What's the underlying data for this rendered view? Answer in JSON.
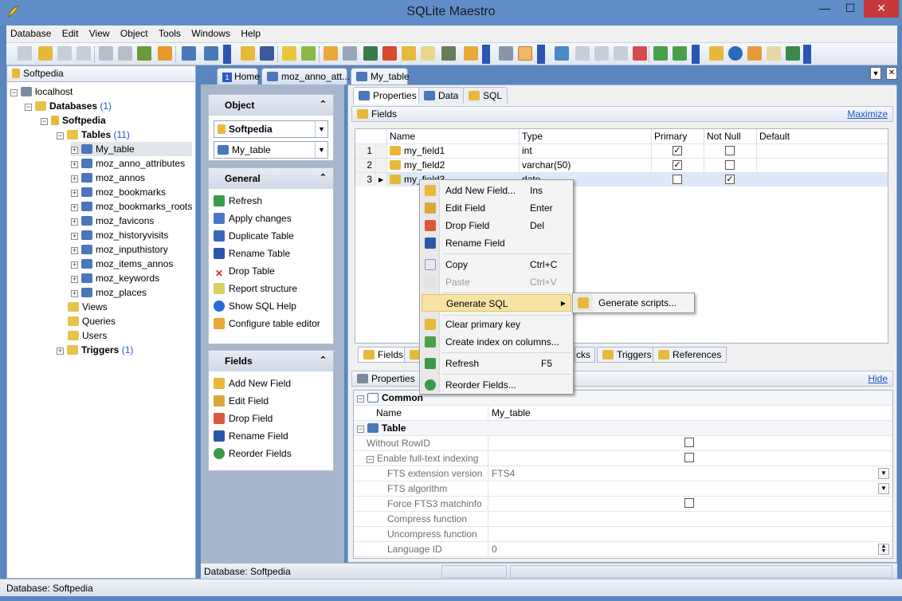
{
  "window": {
    "title": "SQLite Maestro",
    "minimize": "—",
    "maximize": "☐",
    "close": "✕"
  },
  "menu": [
    "Database",
    "Edit",
    "View",
    "Object",
    "Tools",
    "Windows",
    "Help"
  ],
  "left_panel": {
    "title": "Softpedia",
    "tree": {
      "host": "localhost",
      "databases": {
        "label": "Databases",
        "count": "(1)"
      },
      "db": "Softpedia",
      "tables": {
        "label": "Tables",
        "count": "(11)"
      },
      "table_items": [
        "My_table",
        "moz_anno_attributes",
        "moz_annos",
        "moz_bookmarks",
        "moz_bookmarks_roots",
        "moz_favicons",
        "moz_historyvisits",
        "moz_inputhistory",
        "moz_items_annos",
        "moz_keywords",
        "moz_places"
      ],
      "views": "Views",
      "queries": "Queries",
      "users": "Users",
      "triggers": {
        "label": "Triggers",
        "count": "(1)"
      }
    }
  },
  "doc_tabs": {
    "home": "Home",
    "tab2": "moz_anno_att...",
    "tab3": "My_table",
    "home_number": "1"
  },
  "nav": {
    "object": {
      "title": "Object",
      "db_combo": "Softpedia",
      "table_combo": "My_table"
    },
    "general": {
      "title": "General",
      "items": [
        "Refresh",
        "Apply changes",
        "Duplicate Table",
        "Rename Table",
        "Drop Table",
        "Report structure",
        "Show SQL Help",
        "Configure table editor"
      ]
    },
    "fields": {
      "title": "Fields",
      "items": [
        "Add New Field",
        "Edit Field",
        "Drop Field",
        "Rename Field",
        "Reorder Fields"
      ]
    }
  },
  "main": {
    "subtabs": [
      "Properties",
      "Data",
      "SQL"
    ],
    "fields_header": "Fields",
    "maximize": "Maximize",
    "grid": {
      "columns": [
        "Name",
        "Type",
        "Primary",
        "Not Null",
        "Default"
      ],
      "rows": [
        {
          "num": "1",
          "name": "my_field1",
          "type": "int",
          "primary": true,
          "notnull": false
        },
        {
          "num": "2",
          "name": "my_field2",
          "type": "varchar(50)",
          "primary": true,
          "notnull": false
        },
        {
          "num": "3",
          "name": "my_field3",
          "type": "date",
          "primary": false,
          "notnull": true
        }
      ]
    },
    "bottom_tabs": {
      "fields": "Fields",
      "checks_partial": "cks",
      "triggers": "Triggers",
      "references": "References"
    },
    "props_header": "Properties",
    "hide": "Hide",
    "props": {
      "common": "Common",
      "name_label": "Name",
      "name_value": "My_table",
      "table": "Table",
      "without_rowid": "Without RowID",
      "fulltext": "Enable full-text indexing",
      "fts_version": "FTS extension version",
      "fts_version_value": "FTS4",
      "fts_algorithm": "FTS algorithm",
      "force_fts3": "Force FTS3 matchinfo",
      "compress": "Compress function",
      "uncompress": "Uncompress function",
      "language": "Language ID",
      "language_value": "0"
    }
  },
  "context_menu": {
    "items": [
      {
        "label": "Add New Field...",
        "shortcut": "Ins"
      },
      {
        "label": "Edit Field",
        "shortcut": "Enter"
      },
      {
        "label": "Drop Field",
        "shortcut": "Del"
      },
      {
        "label": "Rename Field",
        "shortcut": ""
      },
      {
        "label": "Copy",
        "shortcut": "Ctrl+C"
      },
      {
        "label": "Paste",
        "shortcut": "Ctrl+V"
      },
      {
        "label": "Generate SQL",
        "shortcut": ""
      },
      {
        "label": "Clear primary key",
        "shortcut": ""
      },
      {
        "label": "Create index on columns...",
        "shortcut": ""
      },
      {
        "label": "Refresh",
        "shortcut": "F5"
      },
      {
        "label": "Reorder Fields...",
        "shortcut": ""
      }
    ],
    "submenu": "Generate scripts..."
  },
  "status": {
    "inner": "Database: Softpedia",
    "outer": "Database: Softpedia"
  },
  "colors": {
    "accent": "#5a86c0",
    "highlight": "#f7e3a3",
    "link": "#1f55c8"
  }
}
